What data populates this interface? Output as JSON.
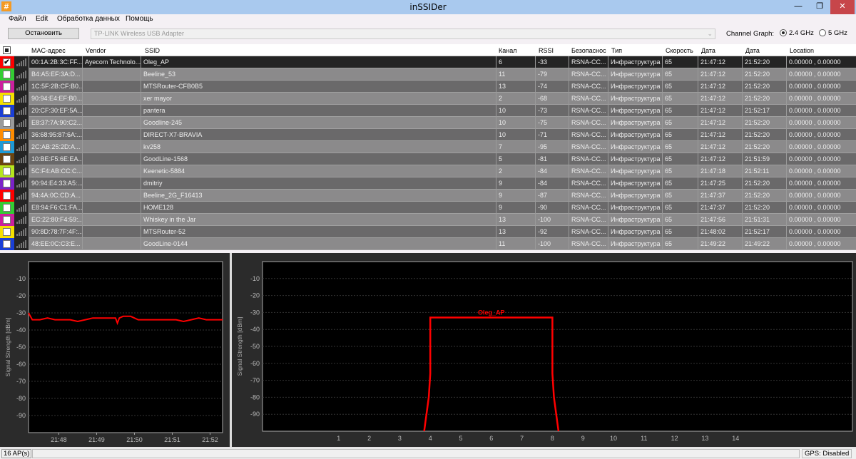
{
  "window": {
    "title": "inSSIDer",
    "app_icon": "#",
    "minimize": "—",
    "maximize": "❐",
    "close": "✕"
  },
  "menu": [
    "Файл",
    "Edit",
    "Обработка данных",
    "Помощь"
  ],
  "toolbar": {
    "stop_label": "Остановить",
    "adapter": "TP-LINK Wireless USB Adapter",
    "channel_graph_label": "Channel Graph:",
    "band_24": "2.4 GHz",
    "band_5": "5 GHz",
    "selected_band": "2.4 GHz"
  },
  "table": {
    "headers": [
      "MAC-адрес",
      "Vendor",
      "SSID",
      "Канал",
      "RSSI",
      "Безопаснос",
      "Тип",
      "Скорость",
      "Дата",
      "Дата",
      "Location"
    ],
    "rows": [
      {
        "color": "#ff0000",
        "checked": true,
        "mac": "00:1A:2B:3C:FF...",
        "vendor": "Ayecom Technolo...",
        "ssid": "Oleg_AP",
        "channel": "6",
        "rssi": "-33",
        "security": "RSNA-CC...",
        "type": "Инфраструктура",
        "speed": "65",
        "first": "21:47:12",
        "last": "21:52:20",
        "location": "0.00000 , 0.00000"
      },
      {
        "color": "#33cc33",
        "checked": false,
        "mac": "B4:A5:EF:3A:D...",
        "vendor": "",
        "ssid": "Beeline_53",
        "channel": "11",
        "rssi": "-79",
        "security": "RSNA-CC...",
        "type": "Инфраструктура",
        "speed": "65",
        "first": "21:47:12",
        "last": "21:52:20",
        "location": "0.00000 , 0.00000"
      },
      {
        "color": "#cc1f9e",
        "checked": false,
        "mac": "1C:5F:2B:CF:B0...",
        "vendor": "",
        "ssid": "MTSRouter-CFB0B5",
        "channel": "13",
        "rssi": "-74",
        "security": "RSNA-CC...",
        "type": "Инфраструктура",
        "speed": "65",
        "first": "21:47:12",
        "last": "21:52:20",
        "location": "0.00000 , 0.00000"
      },
      {
        "color": "#f5e000",
        "checked": false,
        "mac": "90:94:E4:EF:B0...",
        "vendor": "",
        "ssid": "xer mayor",
        "channel": "2",
        "rssi": "-68",
        "security": "RSNA-CC...",
        "type": "Инфраструктура",
        "speed": "65",
        "first": "21:47:12",
        "last": "21:52:20",
        "location": "0.00000 , 0.00000"
      },
      {
        "color": "#1a3fd6",
        "checked": false,
        "mac": "20:CF:30:EF:5A...",
        "vendor": "",
        "ssid": "pantera",
        "channel": "10",
        "rssi": "-73",
        "security": "RSNA-CC...",
        "type": "Инфраструктура",
        "speed": "65",
        "first": "21:47:12",
        "last": "21:52:17",
        "location": "0.00000 , 0.00000"
      },
      {
        "color": "#9a9a9a",
        "checked": false,
        "mac": "E8:37:7A:90:C2...",
        "vendor": "",
        "ssid": "Goodline-245",
        "channel": "10",
        "rssi": "-75",
        "security": "RSNA-CC...",
        "type": "Инфраструктура",
        "speed": "65",
        "first": "21:47:12",
        "last": "21:52:20",
        "location": "0.00000 , 0.00000"
      },
      {
        "color": "#ff8c00",
        "checked": false,
        "mac": "36:68:95:87:6A:...",
        "vendor": "",
        "ssid": "DIRECT-X7-BRAVIA",
        "channel": "10",
        "rssi": "-71",
        "security": "RSNA-CC...",
        "type": "Инфраструктура",
        "speed": "65",
        "first": "21:47:12",
        "last": "21:52:20",
        "location": "0.00000 , 0.00000"
      },
      {
        "color": "#1e9ad6",
        "checked": false,
        "mac": "2C:AB:25:2D:A...",
        "vendor": "",
        "ssid": "kv258",
        "channel": "7",
        "rssi": "-95",
        "security": "RSNA-CC...",
        "type": "Инфраструктура",
        "speed": "65",
        "first": "21:47:12",
        "last": "21:52:20",
        "location": "0.00000 , 0.00000"
      },
      {
        "color": "#6b4410",
        "checked": false,
        "mac": "10:BE:F5:6E:EA...",
        "vendor": "",
        "ssid": "GoodLine-1568",
        "channel": "5",
        "rssi": "-81",
        "security": "RSNA-CC...",
        "type": "Инфраструктура",
        "speed": "65",
        "first": "21:47:12",
        "last": "21:51:59",
        "location": "0.00000 , 0.00000"
      },
      {
        "color": "#b6e61e",
        "checked": false,
        "mac": "5C:F4:AB:CC:C...",
        "vendor": "",
        "ssid": "Keenetic-5884",
        "channel": "2",
        "rssi": "-84",
        "security": "RSNA-CC...",
        "type": "Инфраструктура",
        "speed": "65",
        "first": "21:47:18",
        "last": "21:52:11",
        "location": "0.00000 , 0.00000"
      },
      {
        "color": "#7a22c8",
        "checked": false,
        "mac": "90:94:E4:33:A5:...",
        "vendor": "",
        "ssid": "dmitriy",
        "channel": "9",
        "rssi": "-84",
        "security": "RSNA-CC...",
        "type": "Инфраструктура",
        "speed": "65",
        "first": "21:47:25",
        "last": "21:52:20",
        "location": "0.00000 , 0.00000"
      },
      {
        "color": "#ff0000",
        "checked": false,
        "mac": "94:4A:0C:CD:A...",
        "vendor": "",
        "ssid": "Beeline_2G_F16413",
        "channel": "9",
        "rssi": "-87",
        "security": "RSNA-CC...",
        "type": "Инфраструктура",
        "speed": "65",
        "first": "21:47:37",
        "last": "21:52:20",
        "location": "0.00000 , 0.00000"
      },
      {
        "color": "#33cc33",
        "checked": false,
        "mac": "E8:94:F6:C1:FA...",
        "vendor": "",
        "ssid": "HOME128",
        "channel": "9",
        "rssi": "-90",
        "security": "RSNA-CC...",
        "type": "Инфраструктура",
        "speed": "65",
        "first": "21:47:37",
        "last": "21:52:20",
        "location": "0.00000 , 0.00000"
      },
      {
        "color": "#cc1f9e",
        "checked": false,
        "mac": "EC:22:80:F4:59:...",
        "vendor": "",
        "ssid": "Whiskey in the Jar",
        "channel": "13",
        "rssi": "-100",
        "security": "RSNA-CC...",
        "type": "Инфраструктура",
        "speed": "65",
        "first": "21:47:56",
        "last": "21:51:31",
        "location": "0.00000 , 0.00000"
      },
      {
        "color": "#f5e000",
        "checked": false,
        "mac": "90:8D:78:7F:4F:...",
        "vendor": "",
        "ssid": "MTSRouter-52",
        "channel": "13",
        "rssi": "-92",
        "security": "RSNA-CC...",
        "type": "Инфраструктура",
        "speed": "65",
        "first": "21:48:02",
        "last": "21:52:17",
        "location": "0.00000 , 0.00000"
      },
      {
        "color": "#1a3fd6",
        "checked": false,
        "mac": "48:EE:0C:C3:E...",
        "vendor": "",
        "ssid": "GoodLine-0144",
        "channel": "11",
        "rssi": "-100",
        "security": "RSNA-CC...",
        "type": "Инфраструктура",
        "speed": "65",
        "first": "21:49:22",
        "last": "21:49:22",
        "location": "0.00000 , 0.00000"
      }
    ]
  },
  "chart_data": [
    {
      "type": "line",
      "title": "",
      "ylabel": "Signal Strength [dBm]",
      "xlabel": "",
      "ylim": [
        -100,
        0
      ],
      "yticks": [
        "-10",
        "-20",
        "-30",
        "-40",
        "-50",
        "-60",
        "-70",
        "-80",
        "-90"
      ],
      "xticks": [
        "21:48",
        "21:49",
        "21:50",
        "21:51",
        "21:52"
      ],
      "xlim_minutes": [
        47.2,
        52.33
      ],
      "series": [
        {
          "name": "Oleg_AP",
          "color": "#ff0000",
          "x_minutes": [
            47.2,
            47.3,
            47.5,
            47.7,
            47.9,
            48.1,
            48.3,
            48.5,
            48.7,
            48.9,
            49.1,
            49.3,
            49.5,
            49.55,
            49.6,
            49.7,
            49.9,
            50.1,
            50.3,
            50.5,
            50.7,
            50.9,
            51.1,
            51.3,
            51.5,
            51.7,
            51.9,
            52.1,
            52.33
          ],
          "values": [
            -30,
            -34,
            -34,
            -33,
            -34,
            -34,
            -34,
            -35,
            -34,
            -33,
            -33,
            -33,
            -33,
            -36,
            -33,
            -32,
            -32,
            -34,
            -34,
            -34,
            -34,
            -34,
            -34,
            -35,
            -34,
            -33,
            -34,
            -34,
            -34
          ]
        }
      ]
    },
    {
      "type": "line",
      "ylabel": "Signal Strength [dBm]",
      "ylim": [
        -100,
        0
      ],
      "yticks": [
        "-10",
        "-20",
        "-30",
        "-40",
        "-50",
        "-60",
        "-70",
        "-80",
        "-90"
      ],
      "xticks": [
        "1",
        "2",
        "3",
        "4",
        "5",
        "6",
        "7",
        "8",
        "9",
        "10",
        "11",
        "12",
        "13",
        "14"
      ],
      "series": [
        {
          "name": "Oleg_AP",
          "color": "#ff0000",
          "channel": 6,
          "rssi": -33
        }
      ]
    }
  ],
  "status": {
    "ap_count": "16 AP(s)",
    "gps": "GPS: Disabled"
  }
}
